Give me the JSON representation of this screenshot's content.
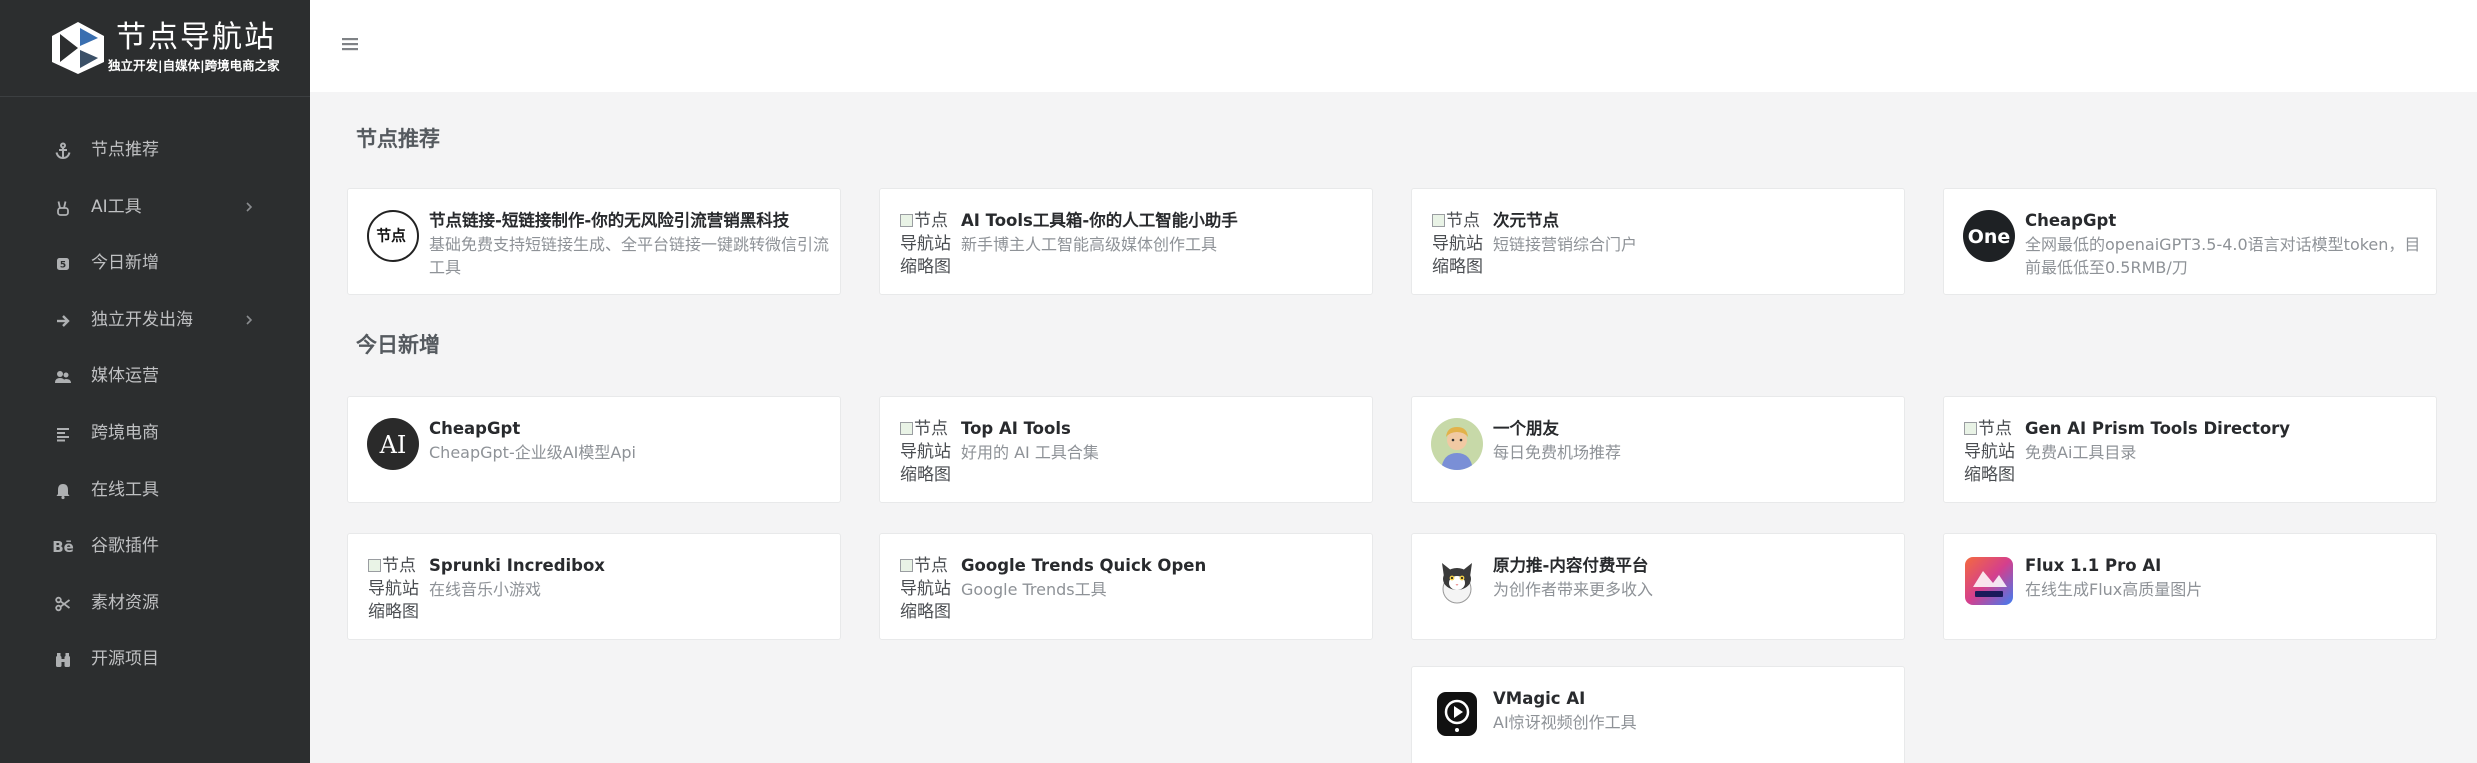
{
  "brand": {
    "title": "节点导航站",
    "subtitle": "独立开发|自媒体|跨境电商之家"
  },
  "sidebar": {
    "items": [
      {
        "label": "节点推荐",
        "icon": "anchor-icon",
        "has_submenu": false
      },
      {
        "label": "AI工具",
        "icon": "hand-peace-icon",
        "has_submenu": true
      },
      {
        "label": "今日新增",
        "icon": "calendar-badge-icon",
        "has_submenu": false
      },
      {
        "label": "独立开发出海",
        "icon": "arrow-right-icon",
        "has_submenu": true
      },
      {
        "label": "媒体运营",
        "icon": "users-icon",
        "has_submenu": false
      },
      {
        "label": "跨境电商",
        "icon": "align-left-icon",
        "has_submenu": false
      },
      {
        "label": "在线工具",
        "icon": "bell-icon",
        "has_submenu": false
      },
      {
        "label": "谷歌插件",
        "icon": "behance-icon",
        "has_submenu": false
      },
      {
        "label": "素材资源",
        "icon": "scissors-icon",
        "has_submenu": false
      },
      {
        "label": "开源项目",
        "icon": "binoculars-icon",
        "has_submenu": false
      }
    ]
  },
  "sections": [
    {
      "title": "节点推荐",
      "cards": [
        {
          "title": "节点链接-短链接制作-你的无风险引流营销黑科技",
          "desc": "基础免费支持短链接生成、全平台链接一键跳转微信引流工具",
          "icon": "jiedian-logo",
          "icon_text": "节点"
        },
        {
          "title": "AI Tools工具箱-你的人工智能小助手",
          "desc": "新手博主人工智能高级媒体创作工具",
          "icon": "broken-image",
          "icon_text": "节点导航站缩略图"
        },
        {
          "title": "次元节点",
          "desc": "短链接营销综合门户",
          "icon": "broken-image",
          "icon_text": "节点导航站缩略图"
        },
        {
          "title": "CheapGpt",
          "desc": "全网最低的openaiGPT3.5-4.0语言对话模型token，目前最低低至0.5RMB/刀",
          "icon": "one-logo",
          "icon_text": "One"
        }
      ]
    },
    {
      "title": "今日新增",
      "cards": [
        {
          "title": "CheapGpt",
          "desc": "CheapGpt-企业级AI模型Api",
          "icon": "ai-logo",
          "icon_text": "AI"
        },
        {
          "title": "Top AI Tools",
          "desc": "好用的 AI 工具合集",
          "icon": "broken-image",
          "icon_text": "节点导航站缩略图"
        },
        {
          "title": "一个朋友",
          "desc": "每日免费机场推荐",
          "icon": "friend-avatar",
          "icon_text": ""
        },
        {
          "title": "Gen AI Prism Tools Directory",
          "desc": "免费Ai工具目录",
          "icon": "broken-image",
          "icon_text": "节点导航站缩略图"
        },
        {
          "title": "Sprunki Incredibox",
          "desc": "在线音乐小游戏",
          "icon": "broken-image",
          "icon_text": "节点导航站缩略图"
        },
        {
          "title": "Google Trends Quick Open",
          "desc": "Google Trends工具",
          "icon": "broken-image",
          "icon_text": "节点导航站缩略图"
        },
        {
          "title": "原力推-内容付费平台",
          "desc": "为创作者带来更多收入",
          "icon": "cat-avatar",
          "icon_text": ""
        },
        {
          "title": "Flux 1.1 Pro AI",
          "desc": "在线生成Flux高质量图片",
          "icon": "flux-logo",
          "icon_text": ""
        },
        {
          "title": "VMagic AI",
          "desc": "AI惊讶视频创作工具",
          "icon": "vmagic-logo",
          "icon_text": ""
        }
      ]
    }
  ]
}
